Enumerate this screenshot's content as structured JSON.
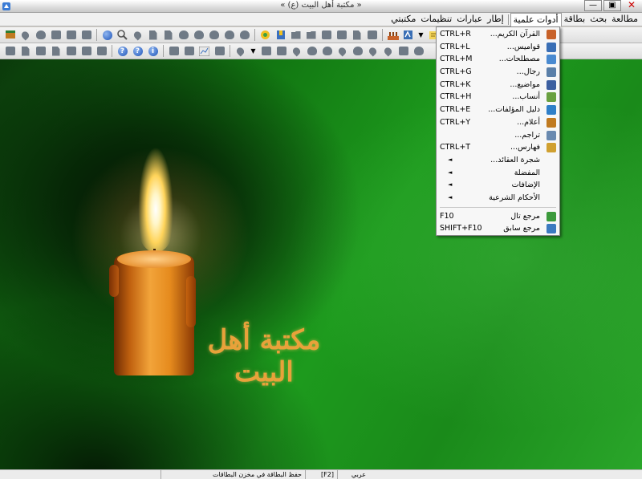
{
  "window": {
    "title": "« مكتبة أهل البيت (ع) »",
    "minimize": "—",
    "maximize": "▣",
    "close": "✕"
  },
  "menubar": {
    "items": [
      {
        "label": "مطالعة"
      },
      {
        "label": "بحث"
      },
      {
        "label": "بطاقة"
      },
      {
        "label": "أدوات علمية",
        "active": true
      },
      {
        "label": "إطار"
      },
      {
        "label": "عبارات"
      },
      {
        "label": "تنظيمات"
      },
      {
        "label": "مكتبتي"
      }
    ]
  },
  "tools_menu": {
    "items": [
      {
        "label": "القرآن الكريم...",
        "shortcut": "CTRL+R",
        "icon": "quran-icon",
        "color": "#c8622a"
      },
      {
        "label": "قواميس...",
        "shortcut": "CTRL+L",
        "icon": "dictionary-icon",
        "color": "#3a6fb5"
      },
      {
        "label": "مصطلحات...",
        "shortcut": "CTRL+M",
        "icon": "terms-icon",
        "color": "#4a8ad0"
      },
      {
        "label": "رجال...",
        "shortcut": "CTRL+G",
        "icon": "narrators-icon",
        "color": "#5a7fa8"
      },
      {
        "label": "مواضيع...",
        "shortcut": "CTRL+K",
        "icon": "topics-icon",
        "color": "#3c5fa0"
      },
      {
        "label": "أنساب...",
        "shortcut": "CTRL+H",
        "icon": "genealogy-icon",
        "color": "#6aa040"
      },
      {
        "label": "دليل المؤلفات...",
        "shortcut": "CTRL+E",
        "icon": "works-guide-icon",
        "color": "#2f7fc8"
      },
      {
        "label": "أعلام...",
        "shortcut": "CTRL+Y",
        "icon": "notables-icon",
        "color": "#c07a20"
      },
      {
        "label": "تراجم...",
        "shortcut": "",
        "icon": "biographies-icon",
        "color": "#6a8ab0"
      },
      {
        "label": "فهارس...",
        "shortcut": "CTRL+T",
        "icon": "indexes-icon",
        "color": "#d0a030"
      },
      {
        "label": "شجرة العقائد...",
        "shortcut": "",
        "arrow": "◄"
      },
      {
        "label": "المفضلة",
        "shortcut": "",
        "arrow": "◄"
      },
      {
        "label": "الإضافات",
        "shortcut": "",
        "arrow": "◄"
      },
      {
        "label": "الأحكام الشرعية",
        "shortcut": "",
        "arrow": "◄"
      }
    ],
    "footer": [
      {
        "label": "مرجع تال",
        "shortcut": "F10",
        "icon": "next-ref-icon",
        "color": "#3c9a3c"
      },
      {
        "label": "مرجع سابق",
        "shortcut": "SHIFT+F10",
        "icon": "prev-ref-icon",
        "color": "#3c7ac0"
      }
    ]
  },
  "stage": {
    "calligraphy": "مكتبة أهل البيت"
  },
  "statusbar": {
    "cells": [
      {
        "text": "حفظ البطاقة في مخزن البطاقات"
      },
      {
        "text": "[F2]"
      },
      {
        "text": "عربي"
      }
    ]
  }
}
